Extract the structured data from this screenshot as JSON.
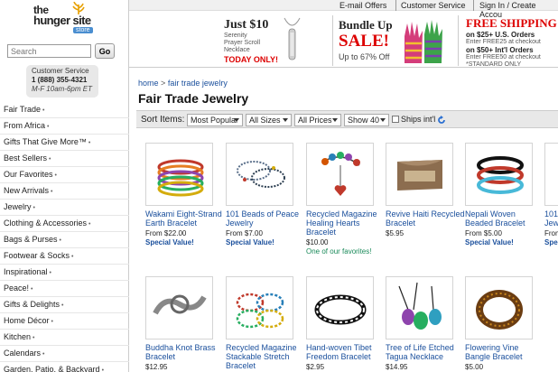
{
  "logo": {
    "line1": "the",
    "line2": "hunger site",
    "badge": "store"
  },
  "search": {
    "placeholder": "Search",
    "button": "Go"
  },
  "customer_service": {
    "title": "Customer Service",
    "phone": "1 (888) 355-4321",
    "hours": "M-F 10am-6pm ET"
  },
  "nav": [
    "Fair Trade",
    "From Africa",
    "Gifts That Give More™",
    "Best Sellers",
    "Our Favorites",
    "New Arrivals",
    "Jewelry",
    "Clothing & Accessories",
    "Bags & Purses",
    "Footwear & Socks",
    "Inspirational",
    "Peace!",
    "Gifts & Delights",
    "Home Décor",
    "Kitchen",
    "Calendars",
    "Garden, Patio, & Backyard"
  ],
  "nav_arrow": "•",
  "top_links": [
    "E-mail Offers",
    "Customer Service",
    "Sign In / Create Accou"
  ],
  "promo1": {
    "headline": "Just $10",
    "line1": "Serenity",
    "line2": "Prayer Scroll",
    "line3": "Necklace",
    "cta": "TODAY ONLY!"
  },
  "promo2": {
    "line1": "Bundle Up",
    "line2": "SALE!",
    "line3": "Up to 67% Off"
  },
  "promo3": {
    "headline": "FREE SHIPPING",
    "l1": "on $25+ U.S. Orders",
    "s1": "Enter FREE25 at checkout",
    "l2": "on $50+ Int'l Orders",
    "s2": "Enter FREE50 at checkout",
    "s3": "*STANDARD ONLY"
  },
  "breadcrumb": {
    "home": "home",
    "sep": ">",
    "current": "fair trade jewelry"
  },
  "page_title": "Fair Trade Jewelry",
  "sort": {
    "label": "Sort Items:",
    "popular": "Most Popular",
    "sizes": "All Sizes",
    "prices": "All Prices",
    "show": "Show 40",
    "ships": "Ships int'l"
  },
  "products_row1": [
    {
      "name": "Wakami Eight-Strand Earth Bracelet",
      "price": "From $22.00",
      "special": "Special Value!",
      "fav": ""
    },
    {
      "name": "101 Beads of Peace Jewelry",
      "price": "From $7.00",
      "special": "Special Value!",
      "fav": ""
    },
    {
      "name": "Recycled Magazine Healing Hearts Bracelet",
      "price": "$10.00",
      "special": "",
      "fav": "One of our favorites!"
    },
    {
      "name": "Revive Haiti Recycled Bracelet",
      "price": "$5.95",
      "special": "",
      "fav": ""
    },
    {
      "name": "Nepali Woven Beaded Bracelet",
      "price": "From $5.00",
      "special": "Special Value!",
      "fav": ""
    },
    {
      "name": "101 Jewe",
      "price": "From",
      "special": "Spec",
      "fav": ""
    }
  ],
  "products_row2": [
    {
      "name": "Buddha Knot Brass Bracelet",
      "price": "$12.95"
    },
    {
      "name": "Recycled Magazine Stackable Stretch Bracelet",
      "price": ""
    },
    {
      "name": "Hand-woven Tibet Freedom Bracelet",
      "price": "$2.95"
    },
    {
      "name": "Tree of Life Etched Tagua Necklace",
      "price": "$14.95"
    },
    {
      "name": "Flowering Vine Bangle Bracelet",
      "price": "$5.00"
    }
  ],
  "colors": {
    "link": "#1a4f9c",
    "sale_red": "#d00000",
    "fav_green": "#1a8a5a",
    "store_badge": "#4a8ed0"
  }
}
